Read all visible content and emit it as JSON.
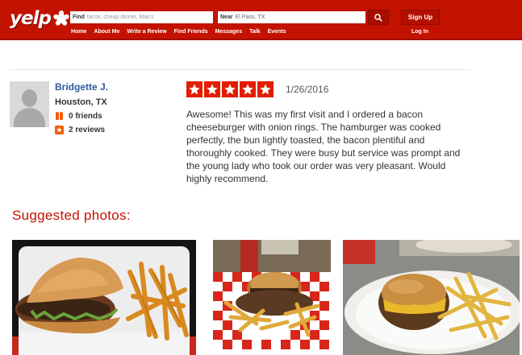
{
  "header": {
    "logo_text": "yelp",
    "find_label": "Find",
    "find_placeholder": "tacos, cheap dinner, Max's",
    "near_label": "Near",
    "near_value": "El Paso, TX",
    "signup_label": "Sign Up",
    "login_label": "Log In",
    "nav": [
      "Home",
      "About Me",
      "Write a Review",
      "Find Friends",
      "Messages",
      "Talk",
      "Events"
    ],
    "brand_color": "#c41200"
  },
  "reviewer": {
    "name": "Bridgette J.",
    "location": "Houston, TX",
    "friends": "0 friends",
    "reviews": "2 reviews"
  },
  "review": {
    "rating": 5,
    "date": "1/26/2016",
    "text": "Awesome! This was my first visit and I ordered a bacon cheeseburger with onion rings. The hamburger was cooked perfectly, the bun lightly toasted, the bacon plentiful and thoroughly cooked. They were busy but service was prompt and the young lady who took our order was very pleasant. Would highly recommend."
  },
  "suggested": {
    "title": "Suggested photos:",
    "photos": [
      "burger-fries-photo",
      "burger-basket-photo",
      "burger-plate-photo"
    ]
  }
}
